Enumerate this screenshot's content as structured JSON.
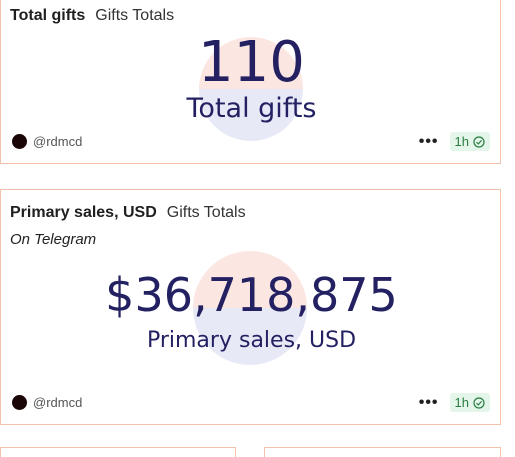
{
  "cards": [
    {
      "title": "Total gifts",
      "category": "Gifts Totals",
      "value": "110",
      "label": "Total gifts",
      "author": "@rdmcd",
      "menu": "•••",
      "age": "1h"
    },
    {
      "title": "Primary sales, USD",
      "category": "Gifts Totals",
      "subtitle": "On Telegram",
      "value": "$36,718,875",
      "label": "Primary sales, USD",
      "author": "@rdmcd",
      "menu": "•••",
      "age": "1h"
    }
  ],
  "colors": {
    "value_text": "#232162",
    "border": "#f0c2ae",
    "badge_bg": "#e4f5e9",
    "badge_text": "#2a7d42"
  },
  "icons": [
    "avatar",
    "more-icon",
    "check-circle-icon"
  ]
}
